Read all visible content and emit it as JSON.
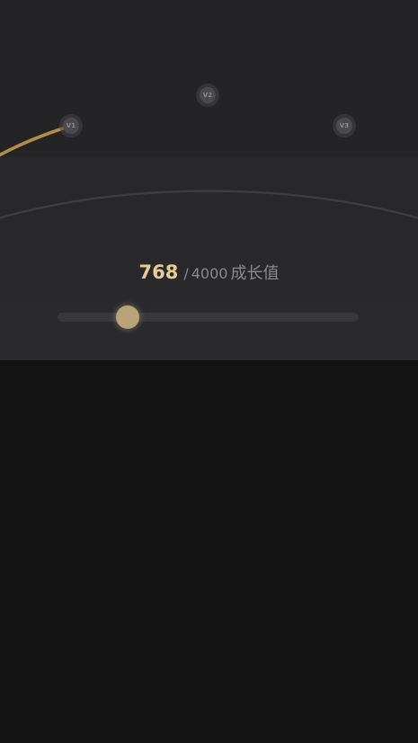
{
  "colors": {
    "progress_arc": "#b08e46",
    "track_arc": "#3e3e40",
    "accent_number": "#e6cc95",
    "thumb": "#b9a479"
  },
  "levels": [
    {
      "label": "V1",
      "reached": true
    },
    {
      "label": "V2",
      "reached": false
    },
    {
      "label": "V3",
      "reached": false
    }
  ],
  "growth": {
    "current": "768",
    "separator": "/",
    "total": "4000",
    "unit": "成长值",
    "progress_fraction": 0.192
  }
}
